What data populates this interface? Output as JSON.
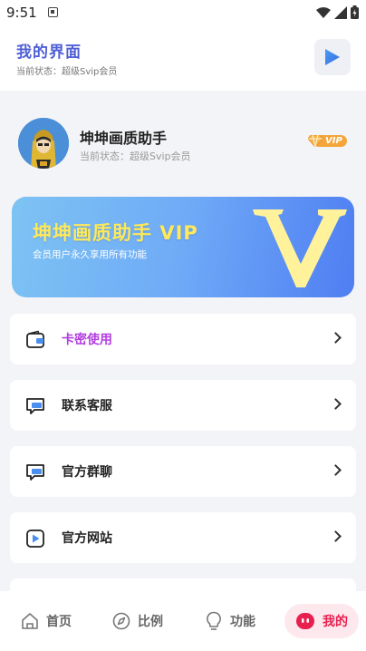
{
  "status_bar": {
    "time": "9:51"
  },
  "header": {
    "title": "我的界面",
    "subtitle": "当前状态：超级Svip会员"
  },
  "profile": {
    "name": "坤坤画质助手",
    "status": "当前状态：超级Svip会员",
    "badge": "VIP"
  },
  "banner": {
    "title": "坤坤画质助手 VIP",
    "subtitle": "会员用户永久享用所有功能",
    "letter": "V"
  },
  "menu": [
    {
      "label": "卡密使用",
      "icon": "wallet-icon"
    },
    {
      "label": "联系客服",
      "icon": "chat-icon"
    },
    {
      "label": "官方群聊",
      "icon": "group-chat-icon"
    },
    {
      "label": "官方网站",
      "icon": "play-square-icon"
    }
  ],
  "nav": [
    {
      "label": "首页",
      "icon": "home-icon"
    },
    {
      "label": "比例",
      "icon": "compass-icon"
    },
    {
      "label": "功能",
      "icon": "lightbulb-icon"
    },
    {
      "label": "我的",
      "icon": "user-face-icon",
      "active": true
    }
  ],
  "colors": {
    "title_blue": "#4f5fd6",
    "accent_purple": "#b33ee0",
    "active_red": "#e8204f",
    "vip_gold": "#f4a63a",
    "banner_text": "#ffe95a"
  }
}
